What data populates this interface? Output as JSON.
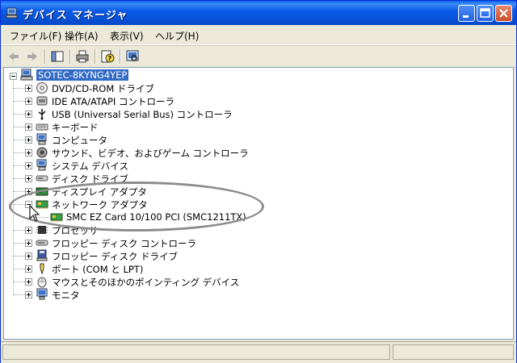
{
  "window": {
    "title": "デバイス マネージャ"
  },
  "menu": [
    {
      "label": "ファイル(F)"
    },
    {
      "label": "操作(A)"
    },
    {
      "label": "表示(V)"
    },
    {
      "label": "ヘルプ(H)"
    }
  ],
  "tree": {
    "root": "SOTEC-8KYNG4YEP",
    "items": [
      {
        "label": "DVD/CD-ROM ドライブ",
        "icon": "cdrom-icon"
      },
      {
        "label": "IDE ATA/ATAPI コントローラ",
        "icon": "ide-controller-icon"
      },
      {
        "label": "USB (Universal Serial Bus) コントローラ",
        "icon": "usb-icon"
      },
      {
        "label": "キーボード",
        "icon": "keyboard-icon"
      },
      {
        "label": "コンピュータ",
        "icon": "computer-icon"
      },
      {
        "label": "サウンド、ビデオ、およびゲーム コントローラ",
        "icon": "sound-icon"
      },
      {
        "label": "システム デバイス",
        "icon": "system-device-icon"
      },
      {
        "label": "ディスク ドライブ",
        "icon": "disk-drive-icon"
      },
      {
        "label": "ディスプレイ アダプタ",
        "icon": "display-adapter-icon"
      },
      {
        "label": "ネットワーク アダプタ",
        "icon": "network-adapter-icon",
        "expanded": true
      },
      {
        "label": "SMC EZ Card 10/100 PCI (SMC1211TX)",
        "icon": "network-card-icon",
        "child": true
      },
      {
        "label": "プロセッサ",
        "icon": "processor-icon"
      },
      {
        "label": "フロッピー ディスク コントローラ",
        "icon": "floppy-controller-icon"
      },
      {
        "label": "フロッピー ディスク ドライブ",
        "icon": "floppy-drive-icon"
      },
      {
        "label": "ポート (COM と LPT)",
        "icon": "port-icon"
      },
      {
        "label": "マウスとそのほかのポインティング デバイス",
        "icon": "mouse-icon"
      },
      {
        "label": "モニタ",
        "icon": "monitor-icon"
      }
    ]
  }
}
